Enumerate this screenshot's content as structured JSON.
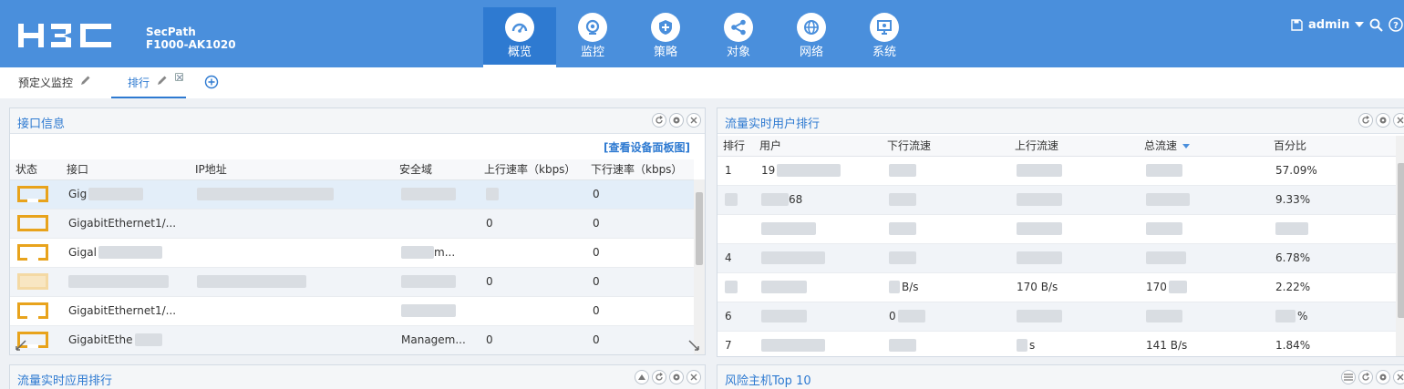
{
  "header": {
    "product_line1": "SecPath",
    "product_line2": "F1000-AK1020",
    "nav": [
      {
        "label": "概览",
        "icon": "dashboard-icon",
        "active": true
      },
      {
        "label": "监控",
        "icon": "monitor-icon",
        "active": false
      },
      {
        "label": "策略",
        "icon": "policy-shield-icon",
        "active": false
      },
      {
        "label": "对象",
        "icon": "object-share-icon",
        "active": false
      },
      {
        "label": "网络",
        "icon": "globe-icon",
        "active": false
      },
      {
        "label": "系统",
        "icon": "system-monitor-icon",
        "active": false
      }
    ],
    "user": "admin"
  },
  "tabs": [
    {
      "label": "预定义监控",
      "active": false
    },
    {
      "label": "排行",
      "active": true
    }
  ],
  "interface_panel": {
    "title": "接口信息",
    "view_link": "[查看设备面板图]",
    "columns": [
      "状态",
      "接口",
      "IP地址",
      "安全域",
      "上行速率（kbps）",
      "下行速率（kbps）"
    ],
    "rows": [
      {
        "iface": "Gig",
        "ip": "",
        "zone": "",
        "up": "",
        "down": "0"
      },
      {
        "iface": "GigabitEthernet1/...",
        "ip": "",
        "zone": "",
        "up": "0",
        "down": "0"
      },
      {
        "iface": "Gigal",
        "ip": "",
        "zone": "m...",
        "up": "",
        "down": "0"
      },
      {
        "iface": "",
        "ip": "",
        "zone": "",
        "up": "0",
        "down": "0"
      },
      {
        "iface": "GigabitEthernet1/...",
        "ip": "",
        "zone": "",
        "up": "",
        "down": "0"
      },
      {
        "iface": "GigabitEthe",
        "ip": "",
        "zone": "Managem...",
        "up": "0",
        "down": "0"
      }
    ]
  },
  "user_rank_panel": {
    "title": "流量实时用户排行",
    "columns": [
      "排行",
      "用户",
      "下行流速",
      "上行流速",
      "总流速",
      "百分比"
    ],
    "rows": [
      {
        "rank": "1",
        "user": "19",
        "down": "",
        "up": "",
        "total": "",
        "pct": "57.09%"
      },
      {
        "rank": "",
        "user": "68",
        "down": "",
        "up": "",
        "total": "",
        "pct": "9.33%"
      },
      {
        "rank": "",
        "user": "",
        "down": "",
        "up": "",
        "total": "",
        "pct": ""
      },
      {
        "rank": "4",
        "user": "",
        "down": "",
        "up": "",
        "total": "",
        "pct": "6.78%"
      },
      {
        "rank": "",
        "user": "",
        "down": "B/s",
        "up": "170 B/s",
        "total": "170",
        "pct": "2.22%"
      },
      {
        "rank": "6",
        "user": "",
        "down": "0",
        "up": "",
        "total": "",
        "pct": "%"
      },
      {
        "rank": "7",
        "user": "",
        "down": "",
        "up": "s",
        "total": "141 B/s",
        "pct": "1.84%"
      }
    ]
  },
  "app_rank_panel": {
    "title": "流量实时应用排行"
  },
  "risk_panel": {
    "title": "风险主机Top 10"
  },
  "colors": {
    "header_bg": "#4a8fdc",
    "active_nav": "#2e7ad1",
    "port_icon": "#e8a31c",
    "title_blue": "#2e7ad1"
  }
}
